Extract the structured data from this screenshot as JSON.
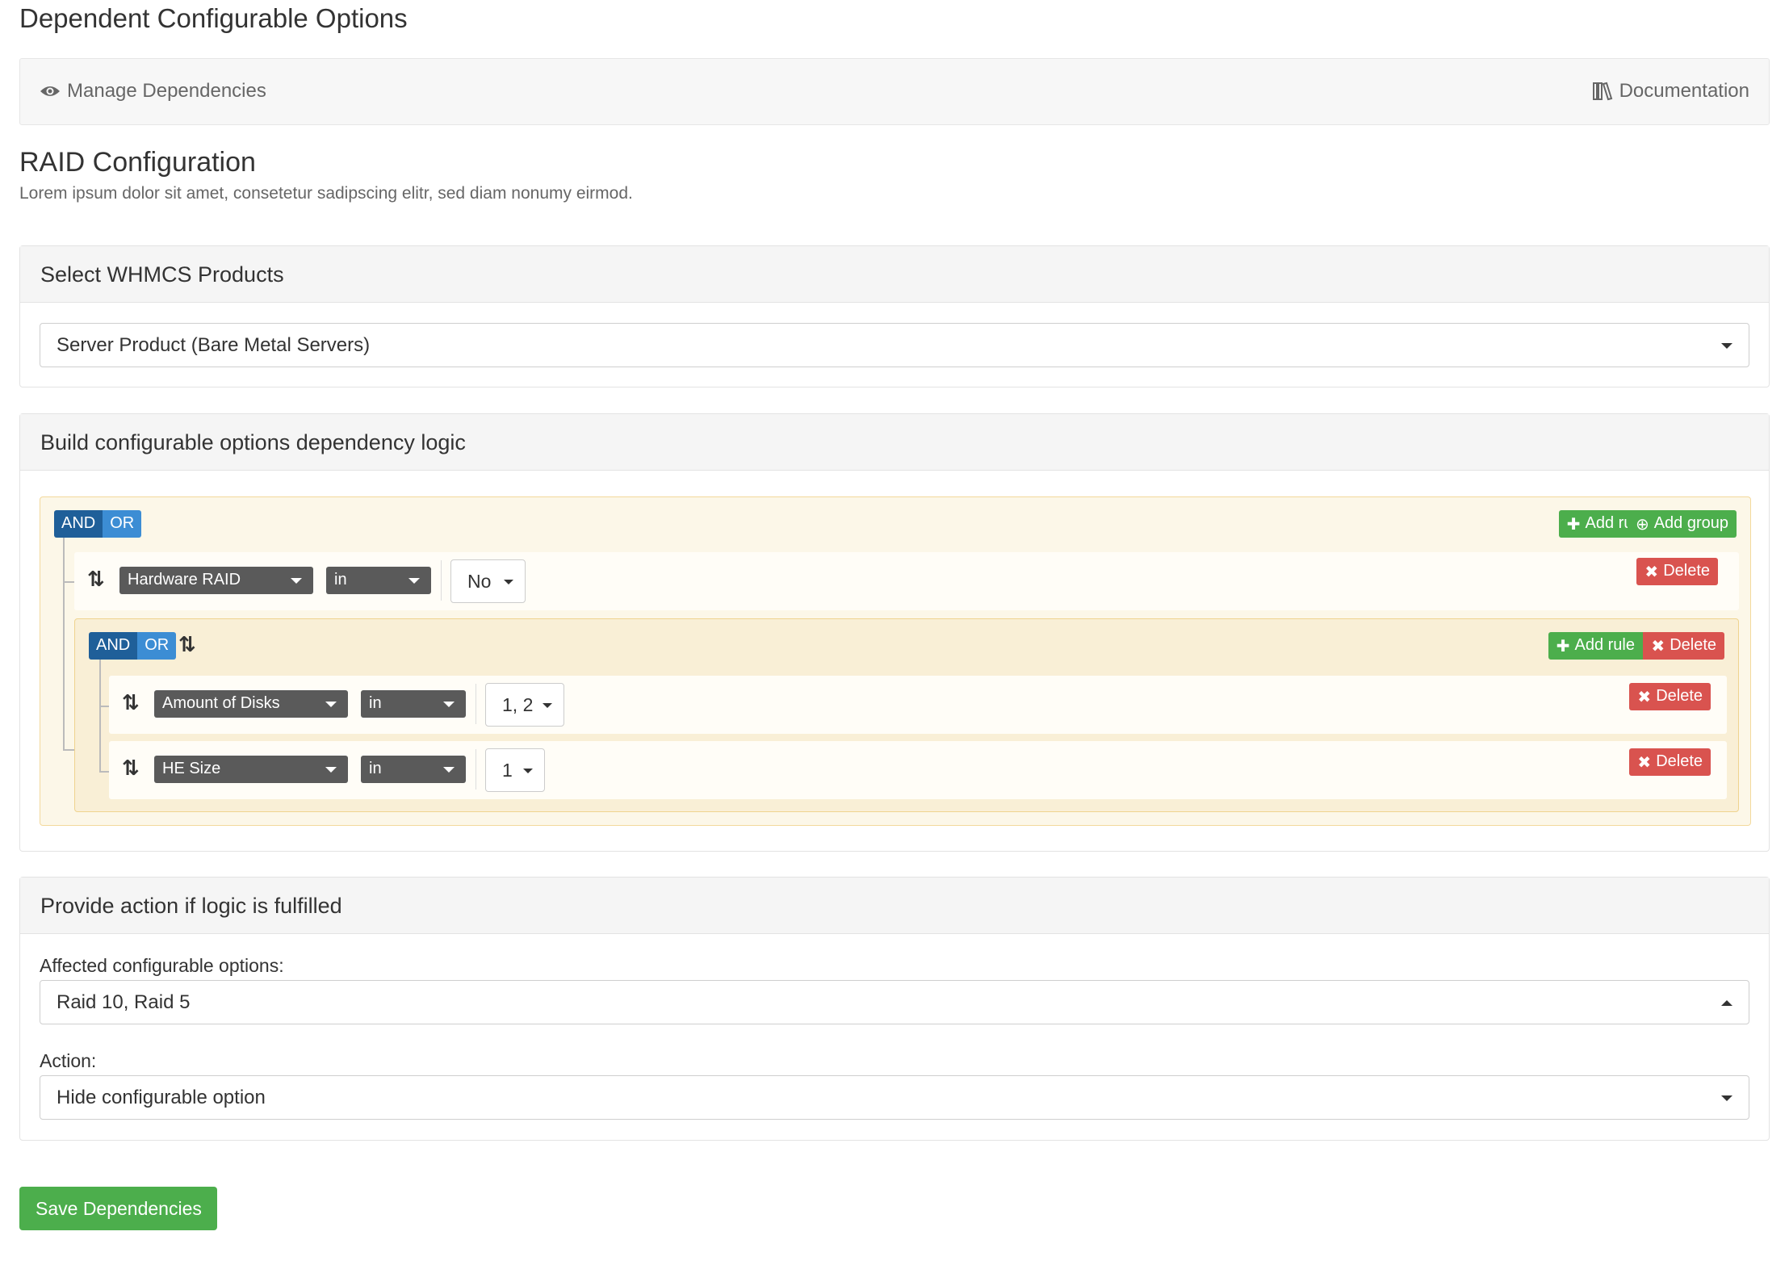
{
  "page": {
    "title": "Dependent Configurable Options",
    "manage_label": "Manage Dependencies",
    "docs_label": "Documentation",
    "section_title": "RAID Configuration",
    "section_subtitle": "Lorem ipsum dolor sit amet, consetetur sadipscing elitr, sed diam nonumy eirmod."
  },
  "products_panel": {
    "title": "Select WHMCS Products",
    "selected": "Server Product (Bare Metal Servers)"
  },
  "logic_panel": {
    "title": "Build configurable options dependency logic",
    "and_label": "AND",
    "or_label": "OR",
    "add_rule_label": "Add rule",
    "add_group_label": "Add group",
    "delete_label": "Delete",
    "rules": [
      {
        "field": "Hardware RAID",
        "operator": "in",
        "value": "No"
      }
    ],
    "subgroup_rules": [
      {
        "field": "Amount of Disks",
        "operator": "in",
        "value": "1, 2"
      },
      {
        "field": "HE Size",
        "operator": "in",
        "value": "1"
      }
    ]
  },
  "action_panel": {
    "title": "Provide action if logic is fulfilled",
    "affected_label": "Affected configurable options:",
    "affected_value": "Raid 10, Raid 5",
    "action_label": "Action:",
    "action_value": "Hide configurable option"
  },
  "save_label": "Save Dependencies",
  "colors": {
    "green": "#4cae4c",
    "red": "#d9534f",
    "and_blue": "#1f5f99",
    "or_blue": "#3c8dd4",
    "group_bg": "#fcf7e8"
  },
  "icons": [
    "eye-icon",
    "books-icon",
    "plus-icon",
    "plus-circle-icon",
    "times-icon",
    "sort-icon",
    "caret-down-icon",
    "caret-up-icon"
  ]
}
